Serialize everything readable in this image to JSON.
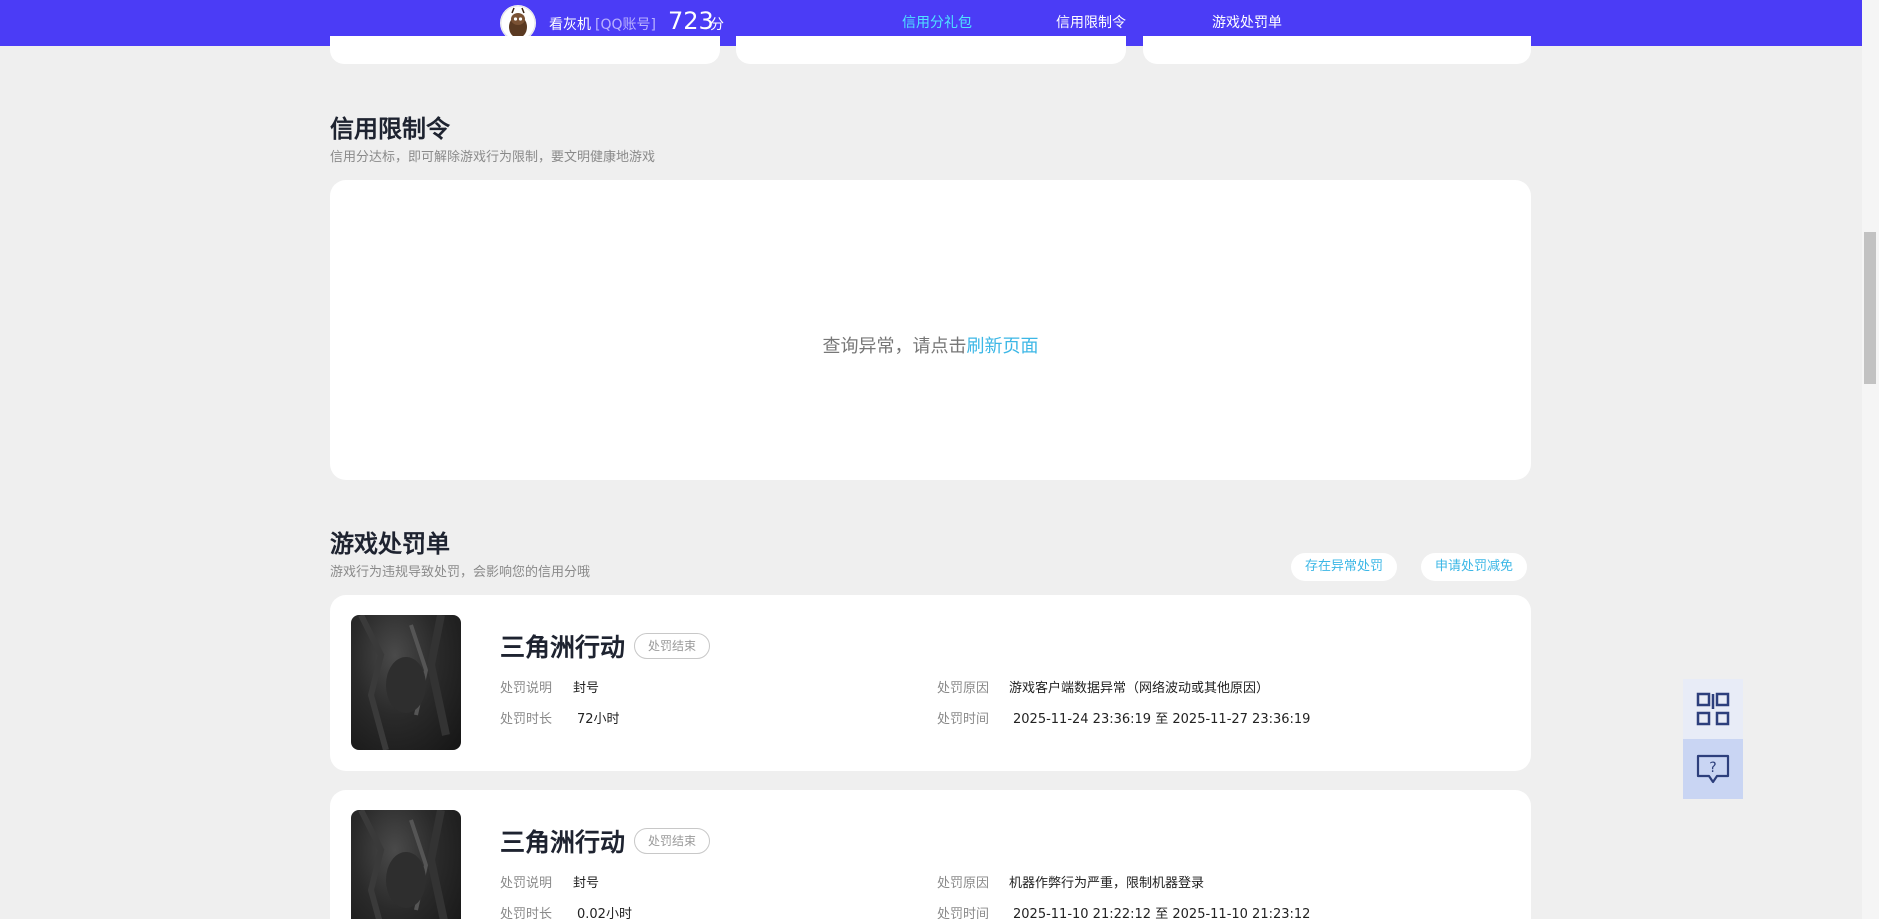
{
  "header": {
    "username": "看灰机",
    "account_type": "[QQ账号]",
    "score": "723",
    "score_unit": "分",
    "nav": [
      "信用分礼包",
      "信用限制令",
      "游戏处罚单"
    ]
  },
  "restriction": {
    "title": "信用限制令",
    "subtitle": "信用分达标，即可解除游戏行为限制，要文明健康地游戏",
    "error_text": "查询异常，请点击",
    "refresh_link": "刷新页面"
  },
  "penalty": {
    "title": "游戏处罚单",
    "subtitle": "游戏行为违规导致处罚，会影响您的信用分哦",
    "btn_abnormal": "存在异常处罚",
    "btn_appeal": "申请处罚减免",
    "labels": {
      "desc": "处罚说明",
      "duration": "处罚时长",
      "reason": "处罚原因",
      "time": "处罚时间",
      "to": "至"
    },
    "items": [
      {
        "game": "三角洲行动",
        "status": "处罚结束",
        "desc": "封号",
        "duration": "72小时",
        "reason": "游戏客户端数据异常（网络波动或其他原因）",
        "start": "2025-11-24 23:36:19",
        "end": "2025-11-27 23:36:19"
      },
      {
        "game": "三角洲行动",
        "status": "处罚结束",
        "desc": "封号",
        "duration": "0.02小时",
        "reason": "机器作弊行为严重，限制机器登录",
        "start": "2025-11-10 21:22:12",
        "end": "2025-11-10 21:23:12"
      }
    ]
  },
  "tools": {
    "qr_icon": "qr-code-icon",
    "help_icon": "help-chat-icon"
  }
}
